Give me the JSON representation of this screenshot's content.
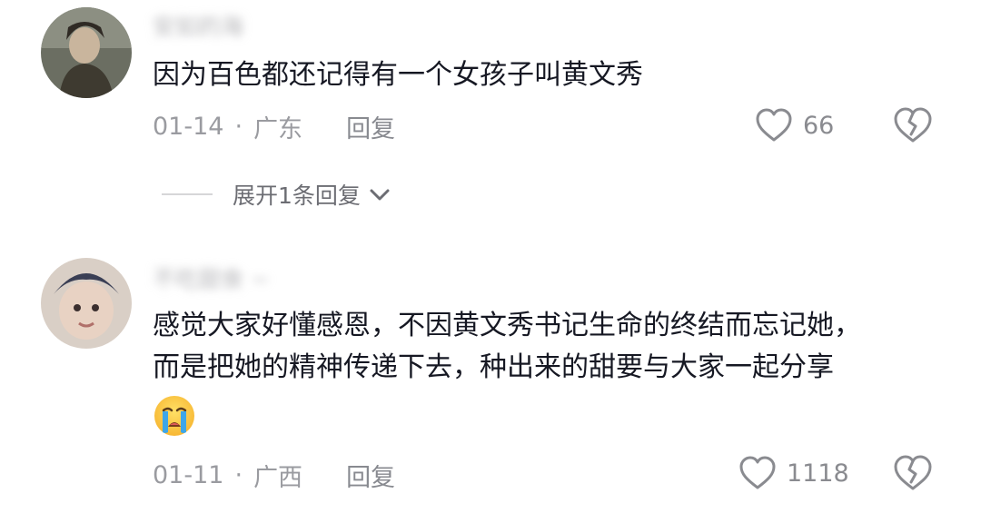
{
  "comments": [
    {
      "username": "安如的海",
      "avatar_icon": "avatar-portrait-dark",
      "text_lines": [
        "因为百色都还记得有一个女孩子叫黄文秀"
      ],
      "date": "01-14",
      "location": "广东",
      "reply_label": "回复",
      "like_count": "66",
      "expand_label": "展开1条回复"
    },
    {
      "username": "不吃甜食 ~",
      "avatar_icon": "avatar-portrait-light",
      "text_lines": [
        "感觉大家好懂感恩，不因黄文秀书记生命的终结而忘记她，",
        "而是把她的精神传递下去，种出来的甜要与大家一起分享"
      ],
      "emoji": "crying-face-emoji",
      "date": "01-11",
      "location": "广西",
      "reply_label": "回复",
      "like_count": "1118"
    }
  ],
  "separator": "·",
  "colors": {
    "text_primary": "#161823",
    "text_secondary": "#9a9ba0",
    "icon_gray": "#8a8b90",
    "background": "#ffffff"
  }
}
